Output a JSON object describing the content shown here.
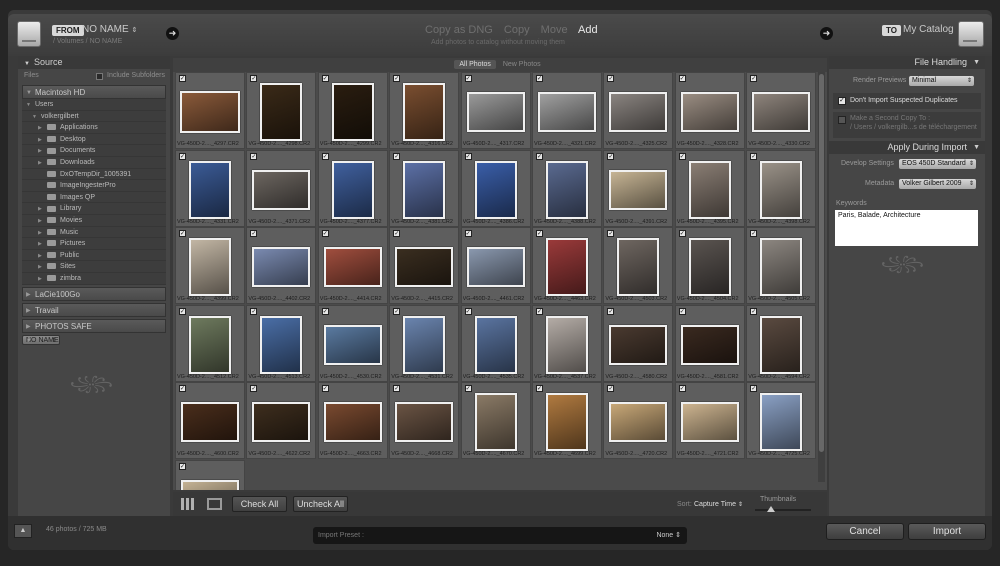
{
  "header": {
    "from_tag": "FROM",
    "from_source": "NO NAME",
    "from_path": "/ Volumes / NO NAME",
    "modes": [
      "Copy as DNG",
      "Copy",
      "Move",
      "Add"
    ],
    "active_mode": "Add",
    "mode_description": "Add photos to catalog without moving them",
    "to_tag": "TO",
    "to_target": "My Catalog",
    "arrow_left": "➜",
    "arrow_right": "➜"
  },
  "source": {
    "title": "Source",
    "files_label": "Files",
    "include_subfolders": "Include Subfolders",
    "volumes": {
      "mac": "Macintosh HD",
      "lacie": "LaCie100Go",
      "travail": "Travail",
      "photos_safe": "PHOTOS SAFE",
      "noname": "NO NAME"
    },
    "users": "Users",
    "user": "volkergilbert",
    "folders": [
      "Applications",
      "Desktop",
      "Documents",
      "Downloads",
      "DxOTempDir_1005391",
      "ImageIngesterPro",
      "Images QP",
      "Library",
      "Movies",
      "Music",
      "Pictures",
      "Public",
      "Sites",
      "zimbra"
    ]
  },
  "grid": {
    "tabs": [
      "All Photos",
      "New Photos"
    ],
    "active_tab": "All Photos",
    "photos": [
      {
        "name": "VG-450D-2...._4297.CR2",
        "color": "#8a5a3a"
      },
      {
        "name": "VG-450D-2...._4298.CR2",
        "color": "#3a2a18"
      },
      {
        "name": "VG-450D-2...._4299.CR2",
        "color": "#2a1d10"
      },
      {
        "name": "VG-450D-2...._4316.CR2",
        "color": "#7a4e30"
      },
      {
        "name": "VG-450D-2...._4317.CR2",
        "color": "#9a9a9a"
      },
      {
        "name": "VG-450D-2...._4321.CR2",
        "color": "#a0a0a0"
      },
      {
        "name": "VG-450D-2...._4325.CR2",
        "color": "#8a8480"
      },
      {
        "name": "VG-450D-2...._4328.CR2",
        "color": "#9a8d82"
      },
      {
        "name": "VG-450D-2...._4330.CR2",
        "color": "#8e847c"
      },
      {
        "name": "VG-450D-2...._4331.CR2",
        "color": "#3b5b96"
      },
      {
        "name": "VG-450D-2...._4371.CR2",
        "color": "#6c6660"
      },
      {
        "name": "VG-450D-2...._4377.CR2",
        "color": "#40609e"
      },
      {
        "name": "VG-450D-2...._4381.CR2",
        "color": "#5c70a6"
      },
      {
        "name": "VG-450D-2...._4386.CR2",
        "color": "#3a5ea8"
      },
      {
        "name": "VG-450D-2...._4388.CR2",
        "color": "#5a6a90"
      },
      {
        "name": "VG-450D-2...._4391.CR2",
        "color": "#c6b494"
      },
      {
        "name": "VG-450D-2...._4395.CR2",
        "color": "#8a7e74"
      },
      {
        "name": "VG-450D-2...._4398.CR2",
        "color": "#9a9288"
      },
      {
        "name": "VG-450D-2...._4399.CR2",
        "color": "#c2b6a4"
      },
      {
        "name": "VG-450D-2...._4402.CR2",
        "color": "#7a8ab0"
      },
      {
        "name": "VG-450D-2...._4414.CR2",
        "color": "#a04e3e"
      },
      {
        "name": "VG-450D-2...._4415.CR2",
        "color": "#3a2e20"
      },
      {
        "name": "VG-450D-2...._4461.CR2",
        "color": "#8a98ae"
      },
      {
        "name": "VG-450D-2...._4463.CR2",
        "color": "#9a3a3a"
      },
      {
        "name": "VG-450D-2...._4503.CR2",
        "color": "#6e6660"
      },
      {
        "name": "VG-450D-2...._4504.CR2",
        "color": "#5a5450"
      },
      {
        "name": "VG-450D-2...._4505.CR2",
        "color": "#8c8680"
      },
      {
        "name": "VG-450D-2...._4512.CR2",
        "color": "#6e7a5e"
      },
      {
        "name": "VG-450D-2...._4513.CR2",
        "color": "#4a6ea6"
      },
      {
        "name": "VG-450D-2...._4530.CR2",
        "color": "#5a7aa0"
      },
      {
        "name": "VG-450D-2...._4531.CR2",
        "color": "#6a84ae"
      },
      {
        "name": "VG-450D-2...._4535.CR2",
        "color": "#5a74a0"
      },
      {
        "name": "VG-450D-2...._4537.CR2",
        "color": "#b4aca6"
      },
      {
        "name": "VG-450D-2...._4580.CR2",
        "color": "#4a3a30"
      },
      {
        "name": "VG-450D-2...._4581.CR2",
        "color": "#3a2a20"
      },
      {
        "name": "VG-450D-2...._4594.CR2",
        "color": "#5a4a40"
      },
      {
        "name": "VG-450D-2...._4600.CR2",
        "color": "#4a2e1c"
      },
      {
        "name": "VG-450D-2...._4622.CR2",
        "color": "#3e2e1e"
      },
      {
        "name": "VG-450D-2...._4663.CR2",
        "color": "#7a4a30"
      },
      {
        "name": "VG-450D-2...._4668.CR2",
        "color": "#6a5444"
      },
      {
        "name": "VG-450D-2...._4670.CR2",
        "color": "#8a7a66"
      },
      {
        "name": "VG-450D-2...._4699.CR2",
        "color": "#b07a40"
      },
      {
        "name": "VG-450D-2...._4720.CR2",
        "color": "#c8a878"
      },
      {
        "name": "VG-450D-2...._4721.CR2",
        "color": "#cdb490"
      },
      {
        "name": "VG-450D-2...._4725.CR2",
        "color": "#8aa0c4"
      },
      {
        "name": "",
        "color": "#c4b294"
      }
    ]
  },
  "grid_bar": {
    "check_all": "Check All",
    "uncheck_all": "Uncheck All",
    "sort_label": "Sort:",
    "sort_value": "Capture Time",
    "thumbnails_label": "Thumbnails"
  },
  "file_handling": {
    "title": "File Handling",
    "render_label": "Render Previews",
    "render_value": "Minimal",
    "dont_import_dupes": "Don't Import Suspected Duplicates",
    "second_copy": "Make a Second Copy To :",
    "second_copy_path": "/ Users / volkergilb...s de téléchargement"
  },
  "apply": {
    "title": "Apply During Import",
    "develop_label": "Develop Settings",
    "develop_value": "EOS 450D Standard",
    "metadata_label": "Metadata",
    "metadata_value": "Volker Gilbert 2009",
    "keywords_label": "Keywords",
    "keywords_value": "Paris, Balade, Architecture"
  },
  "footer": {
    "count": "46 photos / 725 MB",
    "preset_label": "Import Preset :",
    "preset_value": "None",
    "cancel": "Cancel",
    "import": "Import",
    "toggle": "▲"
  },
  "ornament": "꧁꧂"
}
